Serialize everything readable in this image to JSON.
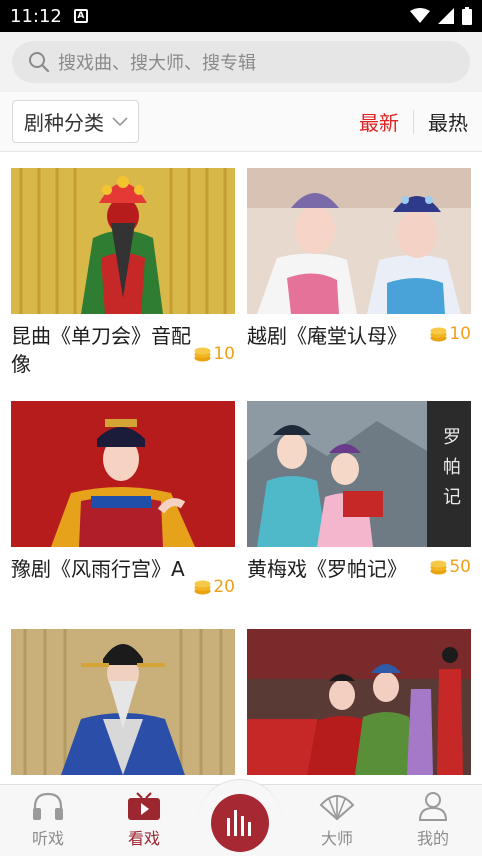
{
  "status_bar": {
    "time": "11:12",
    "notification_badge": "A"
  },
  "search": {
    "placeholder": "搜戏曲、搜大师、搜专辑"
  },
  "filter": {
    "genre_label": "剧种分类",
    "sort_latest": "最新",
    "sort_hot": "最热"
  },
  "items": [
    {
      "title": "昆曲《单刀会》音配像",
      "price": "10",
      "thumb": "kunqu-danda"
    },
    {
      "title": "越剧《庵堂认母》",
      "price": "10",
      "thumb": "yueju-antang"
    },
    {
      "title": "豫剧《风雨行宫》A",
      "price": "20",
      "thumb": "yuju-fengyu"
    },
    {
      "title": "黄梅戏《罗帕记》",
      "price": "50",
      "thumb": "huangmei-luopa",
      "thumb_text": "罗帕记"
    },
    {
      "title": "",
      "price": "",
      "thumb": "opera-elder"
    },
    {
      "title": "",
      "price": "",
      "thumb": "opera-stage"
    }
  ],
  "tabs": [
    {
      "label": "听戏",
      "icon": "headphones-icon",
      "active": false
    },
    {
      "label": "看戏",
      "icon": "tv-icon",
      "active": true
    },
    {
      "label": "",
      "icon": "audio-bars-icon",
      "active": false
    },
    {
      "label": "大师",
      "icon": "fan-icon",
      "active": false
    },
    {
      "label": "我的",
      "icon": "person-icon",
      "active": false
    }
  ],
  "colors": {
    "accent": "#a62833",
    "latest_active": "#e02424",
    "price": "#f0a11a"
  }
}
